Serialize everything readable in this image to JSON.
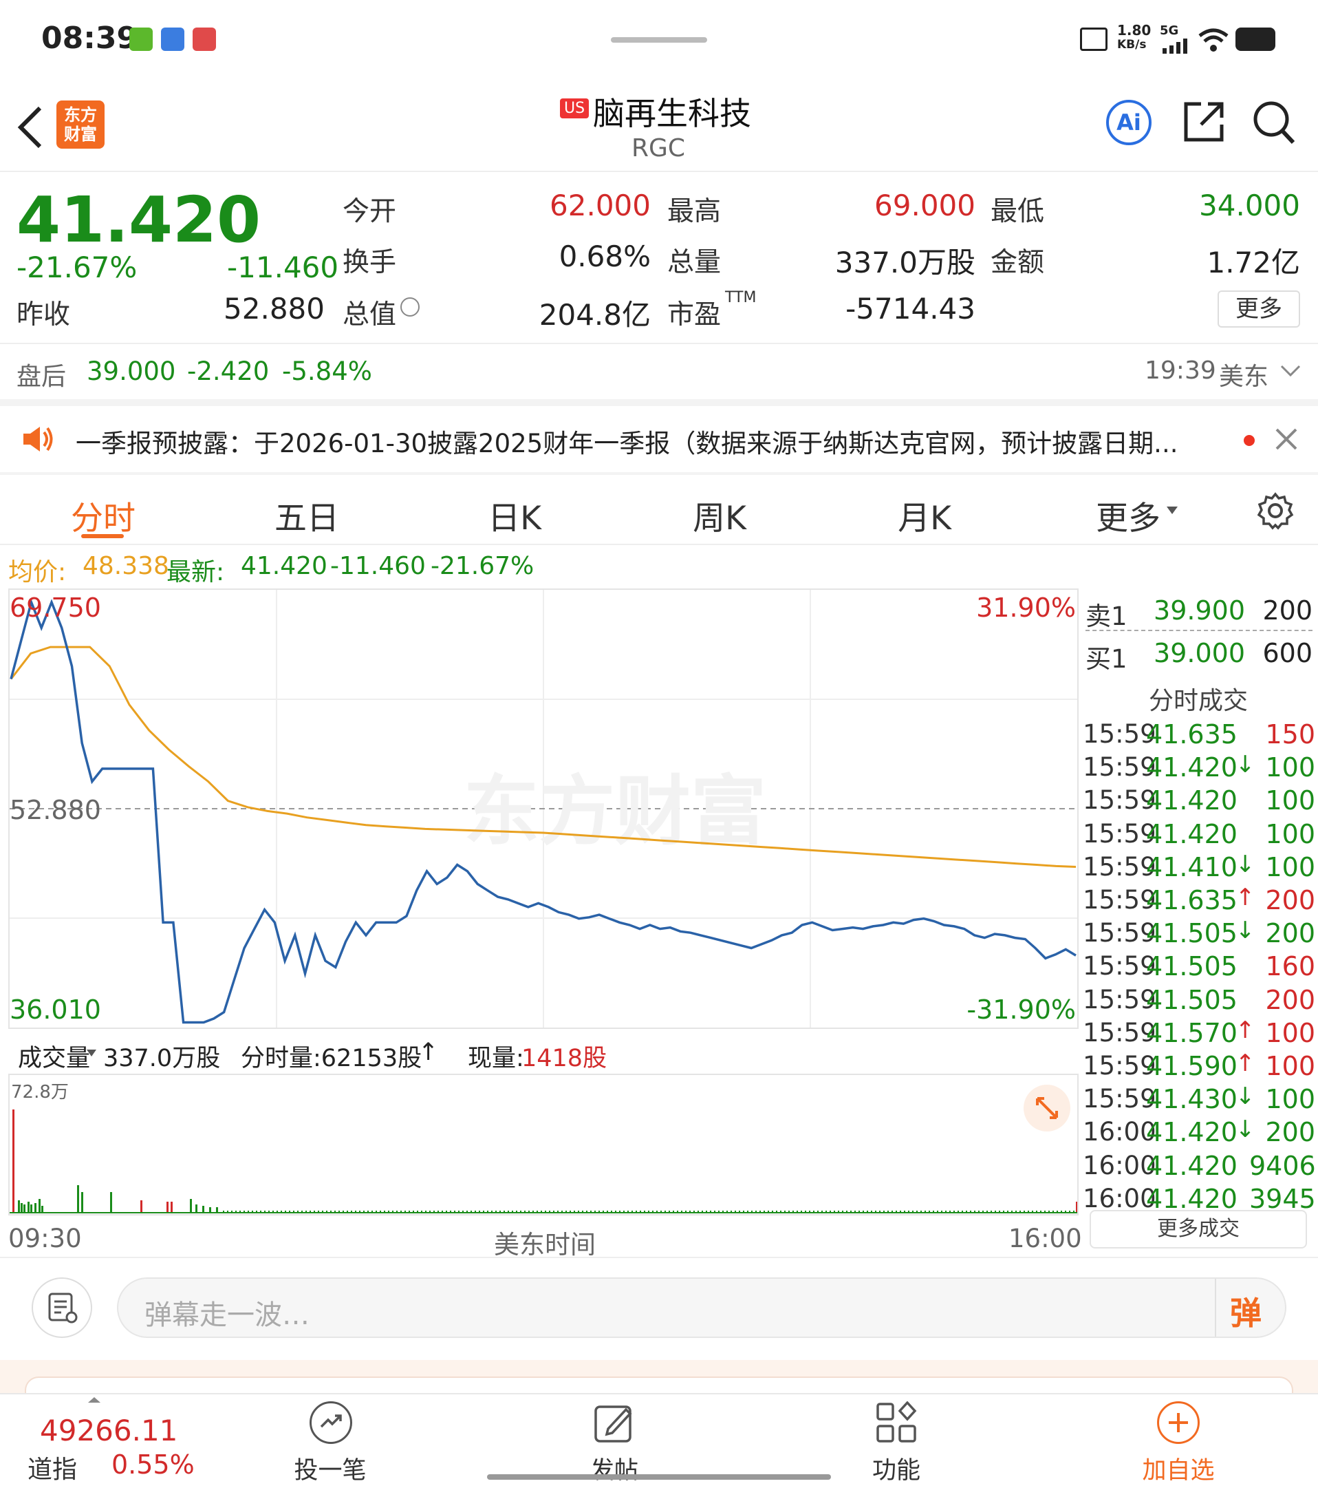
{
  "status_bar": {
    "time": "08:39",
    "net_speed": "1.80",
    "net_unit": "KB/s",
    "net_type": "5G"
  },
  "header": {
    "market_badge": "US",
    "name": "脑再生科技",
    "ticker": "RGC",
    "logo_text": "东方财富",
    "ai_label": "Ai"
  },
  "quote": {
    "last": "41.420",
    "change_pct": "-21.67%",
    "change": "-11.460",
    "prev_close_label": "昨收",
    "prev_close": "52.880",
    "open_label": "今开",
    "open": "62.000",
    "high_label": "最高",
    "high": "69.000",
    "low_label": "最低",
    "low": "34.000",
    "turnover_label": "换手",
    "turnover": "0.68%",
    "volume_label": "总量",
    "volume": "337.0万股",
    "amount_label": "金额",
    "amount": "1.72亿",
    "mktcap_label": "总值",
    "mktcap": "204.8亿",
    "pe_label": "市盈",
    "pe_sup": "TTM",
    "pe": "-5714.43",
    "more_label": "更多"
  },
  "after_hours": {
    "label": "盘后",
    "price": "39.000",
    "change": "-2.420",
    "pct": "-5.84%",
    "time": "19:39",
    "tz": "美东"
  },
  "notice": {
    "text": "一季报预披露：于2026-01-30披露2025财年一季报（数据来源于纳斯达克官网，预计披露日期..."
  },
  "tabs": [
    {
      "label": "分时"
    },
    {
      "label": "五日"
    },
    {
      "label": "日K"
    },
    {
      "label": "周K"
    },
    {
      "label": "月K"
    },
    {
      "label": "更多"
    }
  ],
  "chart_info": {
    "avg_label": "均价:",
    "avg": "48.338",
    "latest_label": "最新:",
    "latest": "41.420",
    "change": "-11.460",
    "pct": "-21.67%"
  },
  "chart_data": {
    "type": "line",
    "y_top_label": "69.750",
    "y_mid_label": "52.880",
    "y_bottom_label": "36.010",
    "pct_top_label": "31.90%",
    "pct_bottom_label": "-31.90%",
    "ylim": [
      36.01,
      69.75
    ],
    "x_start_label": "09:30",
    "x_mid_label": "美东时间",
    "x_end_label": "16:00",
    "series": [
      {
        "name": "最新",
        "color": "#2a62a8",
        "values": [
          63,
          66,
          69,
          67,
          69,
          67,
          64,
          58,
          55,
          56,
          56,
          56,
          56,
          56,
          56,
          44,
          44,
          36.2,
          36.2,
          36.2,
          36.5,
          37,
          39.5,
          42,
          43.5,
          45,
          44,
          41,
          43,
          40,
          43,
          41,
          40.5,
          42.5,
          44,
          43,
          44,
          44,
          44,
          44.5,
          46.5,
          48,
          47,
          47.5,
          48.5,
          48,
          47,
          46.5,
          46,
          45.8,
          45.5,
          45.2,
          45.5,
          45.2,
          44.8,
          44.6,
          44.3,
          44.4,
          44.6,
          44.3,
          44,
          43.8,
          43.5,
          43.8,
          43.5,
          43.6,
          43.3,
          43.2,
          43,
          42.8,
          42.6,
          42.4,
          42.2,
          42,
          42.3,
          42.6,
          43,
          43.2,
          43.8,
          44,
          43.7,
          43.4,
          43.5,
          43.6,
          43.5,
          43.7,
          43.8,
          44,
          43.9,
          44.2,
          44.3,
          44.1,
          43.8,
          43.7,
          43.5,
          43,
          42.8,
          43.1,
          43,
          42.8,
          42.7,
          42,
          41.2,
          41.5,
          41.9,
          41.42
        ]
      },
      {
        "name": "均价",
        "color": "#e8a020",
        "values": [
          63,
          65,
          65.5,
          65.5,
          65.5,
          64,
          61,
          59,
          57.5,
          56.2,
          55,
          53.5,
          53,
          52.7,
          52.5,
          52.2,
          52,
          51.8,
          51.6,
          51.5,
          51.4,
          51.3,
          51.25,
          51.2,
          51.15,
          51.1,
          51.05,
          51,
          50.9,
          50.8,
          50.7,
          50.6,
          50.5,
          50.4,
          50.3,
          50.2,
          50.1,
          50,
          49.9,
          49.8,
          49.7,
          49.6,
          49.5,
          49.4,
          49.3,
          49.2,
          49.1,
          49.0,
          48.9,
          48.8,
          48.7,
          48.6,
          48.5,
          48.4,
          48.34
        ]
      }
    ]
  },
  "order_book": {
    "ask_label": "卖1",
    "ask_price": "39.900",
    "ask_qty": "200",
    "bid_label": "买1",
    "bid_price": "39.000",
    "bid_qty": "600",
    "trades_title": "分时成交",
    "trades": [
      {
        "time": "15:59",
        "price": "41.635",
        "dir": "",
        "qty": "150",
        "qty_color": "red"
      },
      {
        "time": "15:59",
        "price": "41.420",
        "dir": "↓",
        "qty": "100",
        "qty_color": "green"
      },
      {
        "time": "15:59",
        "price": "41.420",
        "dir": "",
        "qty": "100",
        "qty_color": "green"
      },
      {
        "time": "15:59",
        "price": "41.420",
        "dir": "",
        "qty": "100",
        "qty_color": "green"
      },
      {
        "time": "15:59",
        "price": "41.410",
        "dir": "↓",
        "qty": "100",
        "qty_color": "green"
      },
      {
        "time": "15:59",
        "price": "41.635",
        "dir": "↑",
        "qty": "200",
        "qty_color": "red"
      },
      {
        "time": "15:59",
        "price": "41.505",
        "dir": "↓",
        "qty": "200",
        "qty_color": "green"
      },
      {
        "time": "15:59",
        "price": "41.505",
        "dir": "",
        "qty": "160",
        "qty_color": "red"
      },
      {
        "time": "15:59",
        "price": "41.505",
        "dir": "",
        "qty": "200",
        "qty_color": "red"
      },
      {
        "time": "15:59",
        "price": "41.570",
        "dir": "↑",
        "qty": "100",
        "qty_color": "red"
      },
      {
        "time": "15:59",
        "price": "41.590",
        "dir": "↑",
        "qty": "100",
        "qty_color": "red"
      },
      {
        "time": "15:59",
        "price": "41.430",
        "dir": "↓",
        "qty": "100",
        "qty_color": "green"
      },
      {
        "time": "16:00",
        "price": "41.420",
        "dir": "↓",
        "qty": "200",
        "qty_color": "green"
      },
      {
        "time": "16:00",
        "price": "41.420",
        "dir": "",
        "qty": "9406",
        "qty_color": "green"
      },
      {
        "time": "16:00",
        "price": "41.420",
        "dir": "",
        "qty": "3945",
        "qty_color": "green"
      }
    ],
    "more_trades": "更多成交"
  },
  "volume_bar": {
    "label": "成交量",
    "total": "337.0万股",
    "minute_label": "分时量:62153股",
    "arrow": "↑",
    "now_label": "现量:",
    "now": "1418股",
    "max_label": "72.8万"
  },
  "comment": {
    "placeholder": "弹幕走一波…",
    "danmu": "弹"
  },
  "bottom_nav": {
    "index_value": "49266.11",
    "index_name": "道指",
    "index_pct": "0.55%",
    "items": [
      {
        "label": "投一笔"
      },
      {
        "label": "发帖"
      },
      {
        "label": "功能"
      },
      {
        "label": "加自选"
      }
    ]
  }
}
